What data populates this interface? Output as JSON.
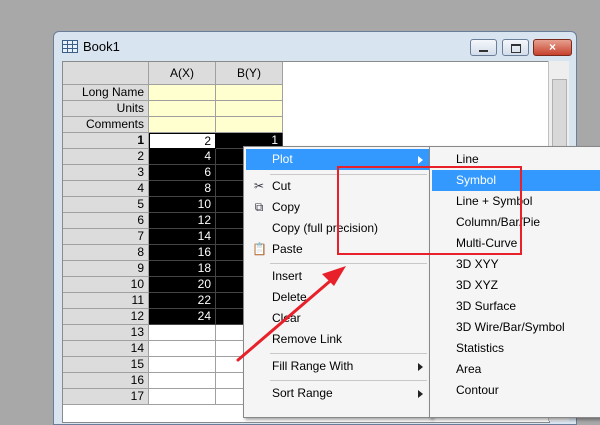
{
  "window": {
    "title": "Book1"
  },
  "columns": [
    {
      "label": "A(X)"
    },
    {
      "label": "B(Y)"
    }
  ],
  "meta_rows": [
    {
      "label": "Long Name"
    },
    {
      "label": "Units"
    },
    {
      "label": "Comments"
    }
  ],
  "rows": [
    {
      "n": "1",
      "a": "2",
      "b": "1"
    },
    {
      "n": "2",
      "a": "4",
      "b": ""
    },
    {
      "n": "3",
      "a": "6",
      "b": ""
    },
    {
      "n": "4",
      "a": "8",
      "b": ""
    },
    {
      "n": "5",
      "a": "10",
      "b": ""
    },
    {
      "n": "6",
      "a": "12",
      "b": ""
    },
    {
      "n": "7",
      "a": "14",
      "b": ""
    },
    {
      "n": "8",
      "a": "16",
      "b": ""
    },
    {
      "n": "9",
      "a": "18",
      "b": ""
    },
    {
      "n": "10",
      "a": "20",
      "b": ""
    },
    {
      "n": "11",
      "a": "22",
      "b": ""
    },
    {
      "n": "12",
      "a": "24",
      "b": ""
    },
    {
      "n": "13",
      "a": "",
      "b": ""
    },
    {
      "n": "14",
      "a": "",
      "b": ""
    },
    {
      "n": "15",
      "a": "",
      "b": ""
    },
    {
      "n": "16",
      "a": "",
      "b": ""
    },
    {
      "n": "17",
      "a": "",
      "b": ""
    }
  ],
  "context_menu": {
    "items": [
      {
        "label": "Plot",
        "submenu": true,
        "highlighted": true
      },
      {
        "label": "Cut",
        "icon": "scissors-icon"
      },
      {
        "label": "Copy",
        "icon": "copy-icon"
      },
      {
        "label": "Copy (full precision)"
      },
      {
        "label": "Paste",
        "icon": "paste-icon"
      },
      {
        "label": "Insert"
      },
      {
        "label": "Delete"
      },
      {
        "label": "Clear"
      },
      {
        "label": "Remove Link"
      },
      {
        "label": "Fill Range With",
        "submenu": true
      },
      {
        "label": "Sort Range",
        "submenu": true
      }
    ]
  },
  "plot_submenu": {
    "items": [
      {
        "label": "Line"
      },
      {
        "label": "Symbol",
        "highlighted": true
      },
      {
        "label": "Line + Symbol"
      },
      {
        "label": "Column/Bar/Pie"
      },
      {
        "label": "Multi-Curve"
      },
      {
        "label": "3D XYY"
      },
      {
        "label": "3D XYZ"
      },
      {
        "label": "3D Surface"
      },
      {
        "label": "3D Wire/Bar/Symbol"
      },
      {
        "label": "Statistics"
      },
      {
        "label": "Area"
      },
      {
        "label": "Contour"
      }
    ]
  },
  "annotation": {
    "box_color": "#e8202a",
    "arrow_color": "#e8202a"
  },
  "colors": {
    "highlight": "#3399ff",
    "selection": "#000000",
    "meta_bg": "#ffffd0"
  }
}
